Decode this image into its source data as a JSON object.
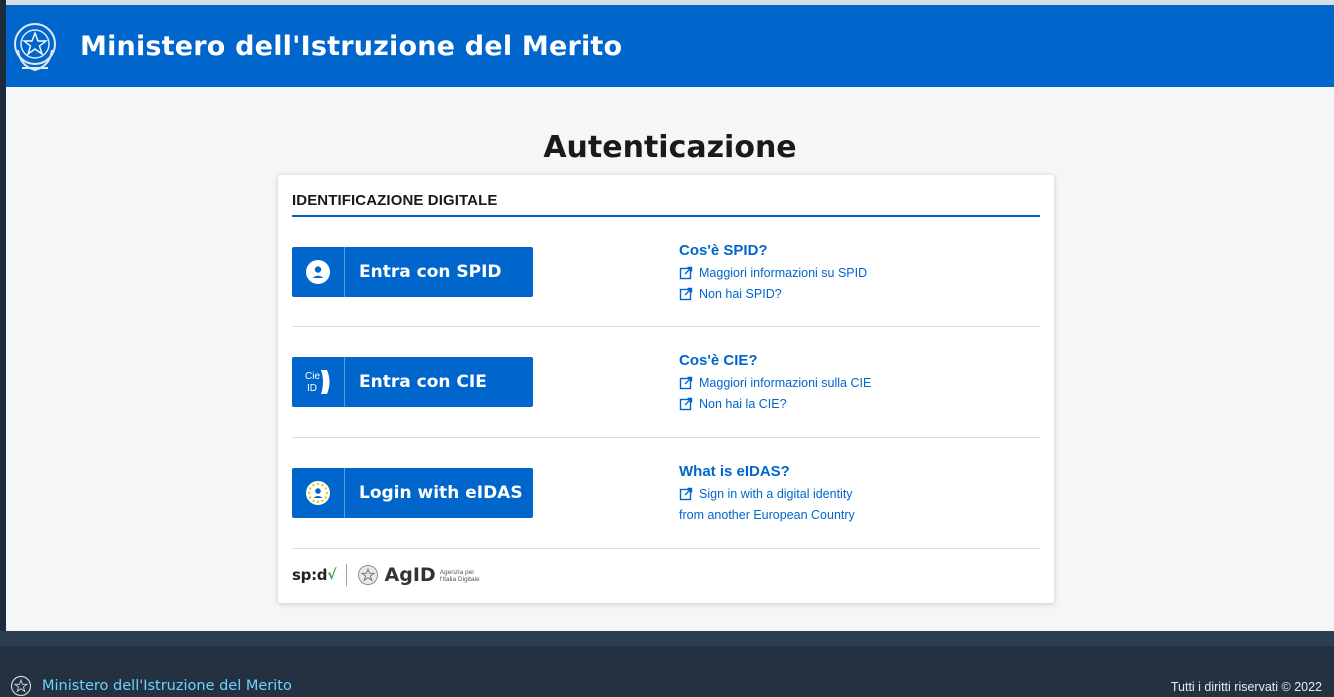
{
  "header": {
    "title": "Ministero dell'Istruzione del Merito",
    "emblem_icon": "italian-republic-emblem-icon"
  },
  "page": {
    "title": "Autenticazione"
  },
  "card": {
    "section_title": "IDENTIFICAZIONE DIGITALE",
    "methods": [
      {
        "button_label": "Entra con SPID",
        "button_icon": "user-icon",
        "info_title": "Cos'è SPID?",
        "links": [
          "Maggiori informazioni su SPID",
          "Non hai SPID?"
        ]
      },
      {
        "button_label": "Entra con CIE",
        "button_icon": "cie-id-icon",
        "icon_text_top": "Cie",
        "icon_text_bottom": "ID",
        "info_title": "Cos'è CIE?",
        "links": [
          "Maggiori informazioni sulla CIE",
          "Non hai la CIE?"
        ]
      },
      {
        "button_label": "Login with eIDAS",
        "button_icon": "eidas-icon",
        "info_title": "What is eIDAS?",
        "links": [
          "Sign in with a digital identity"
        ],
        "link_continuation": "from another European Country"
      }
    ],
    "brand": {
      "spid_text": "sp:d",
      "spid_check": "√",
      "agid_text": "AgID",
      "agid_sub_line1": "Agenzia per",
      "agid_sub_line2": "l'Italia Digitale"
    }
  },
  "footer": {
    "name": "Ministero dell'Istruzione del Merito",
    "copyright": "Tutti i diritti riservati © 2022"
  },
  "colors": {
    "primary": "#0066cc",
    "header_bg": "#0066cc",
    "footer_bg": "#233140",
    "footer_link": "#6ad3ff",
    "page_bg": "#f5f6f7"
  }
}
